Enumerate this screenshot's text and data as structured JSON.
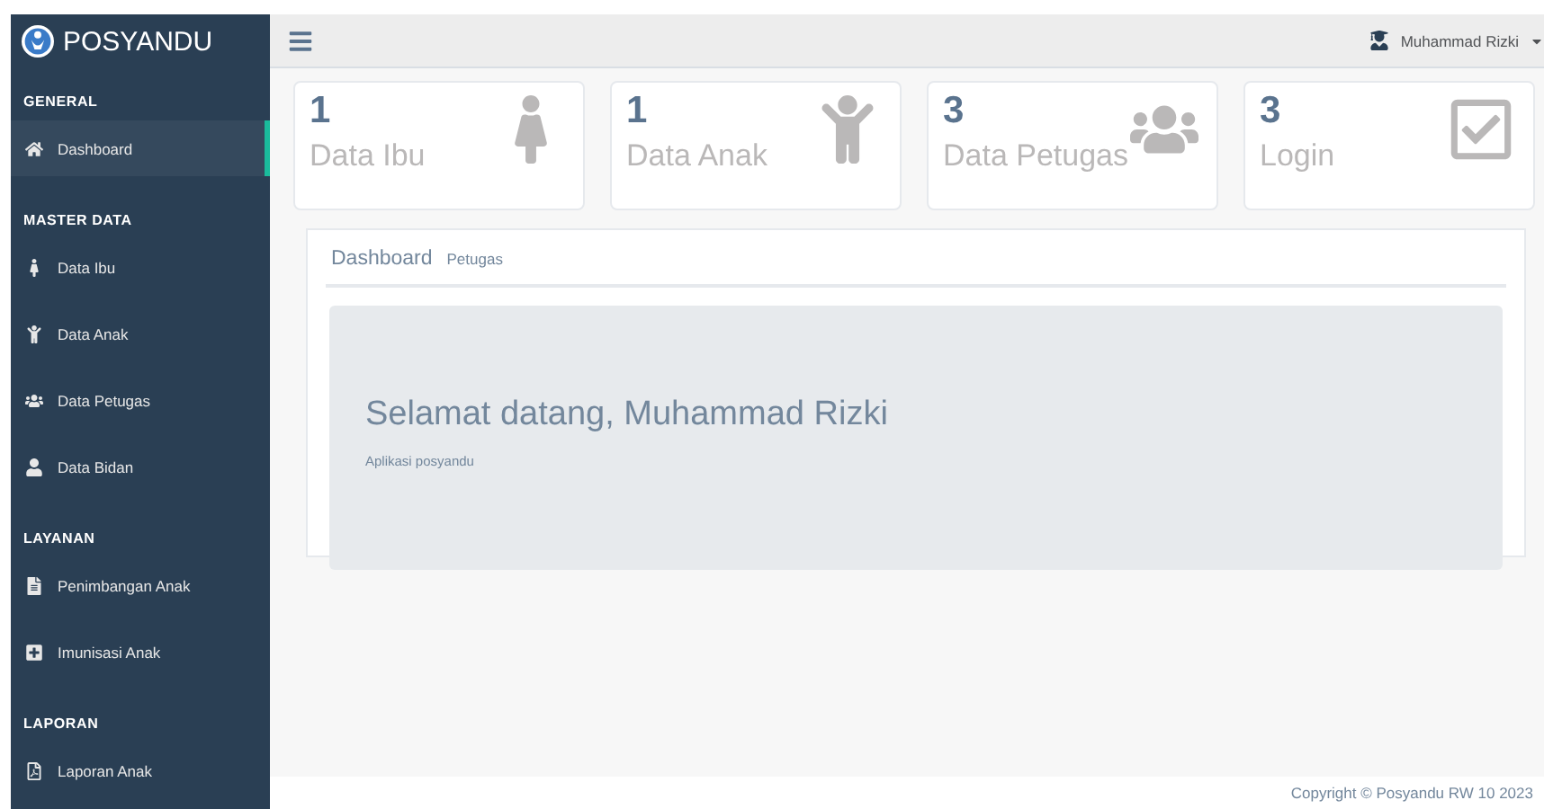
{
  "brand": {
    "name": "POSYANDU"
  },
  "sidebar": {
    "sections": [
      {
        "title": "GENERAL",
        "items": [
          {
            "label": "Dashboard",
            "selected": true
          }
        ]
      },
      {
        "title": "MASTER DATA",
        "items": [
          {
            "label": "Data Ibu",
            "selected": false
          },
          {
            "label": "Data Anak",
            "selected": false
          },
          {
            "label": "Data Petugas",
            "selected": false
          },
          {
            "label": "Data Bidan",
            "selected": false
          }
        ]
      },
      {
        "title": "LAYANAN",
        "items": [
          {
            "label": "Penimbangan Anak",
            "selected": false
          },
          {
            "label": "Imunisasi Anak",
            "selected": false
          }
        ]
      },
      {
        "title": "LAPORAN",
        "items": [
          {
            "label": "Laporan Anak",
            "selected": false
          }
        ]
      }
    ]
  },
  "topbar": {
    "user": "Muhammad Rizki"
  },
  "cards": [
    {
      "count": "1",
      "label": "Data Ibu"
    },
    {
      "count": "1",
      "label": "Data Anak"
    },
    {
      "count": "3",
      "label": "Data Petugas"
    },
    {
      "count": "3",
      "label": "Login"
    }
  ],
  "panel": {
    "title": "Dashboard",
    "subtitle": "Petugas",
    "welcome": "Selamat datang, Muhammad Rizki",
    "description": "Aplikasi posyandu"
  },
  "footer": "Copyright © Posyandu RW 10 2023"
}
